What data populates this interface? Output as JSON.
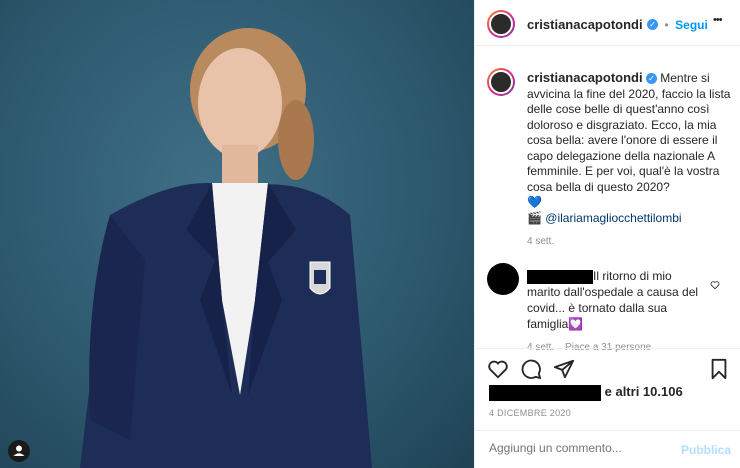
{
  "post": {
    "username": "cristianacapotondi",
    "follow_label": "Segui",
    "more_label": "•••",
    "caption": "Mentre si avvicina la fine del 2020, faccio la lista delle cose belle di quest'anno così doloroso e disgraziato. Ecco, la mia cosa bella: avere l'onore di essere il capo delegazione della nazionale A femminile. E per voi, qual'è la vostra cosa bella di questo 2020?",
    "emoji": "💙",
    "credit_icon": "🎬",
    "credit_handle": "@ilariamagliocchettilombi",
    "time_ago": "4 sett."
  },
  "comment": {
    "text": "Il ritorno di mio marito dall'ospedale a causa del covid... è tornato dalla sua famiglia",
    "emoji": "💟",
    "time_ago": "4 sett.",
    "likes_label": "Piace a 31 persone"
  },
  "likes_suffix": "e altri 10.106",
  "date": "4 DICEMBRE 2020",
  "add_comment_placeholder": "Aggiungi un commento...",
  "publish_label": "Pubblica",
  "colors": {
    "accent": "#0095f6",
    "background_photo": "#2e5a70"
  },
  "icons": [
    "heart-icon",
    "comment-icon",
    "share-icon",
    "bookmark-icon",
    "more-icon",
    "verified-icon",
    "user-tag-icon"
  ]
}
